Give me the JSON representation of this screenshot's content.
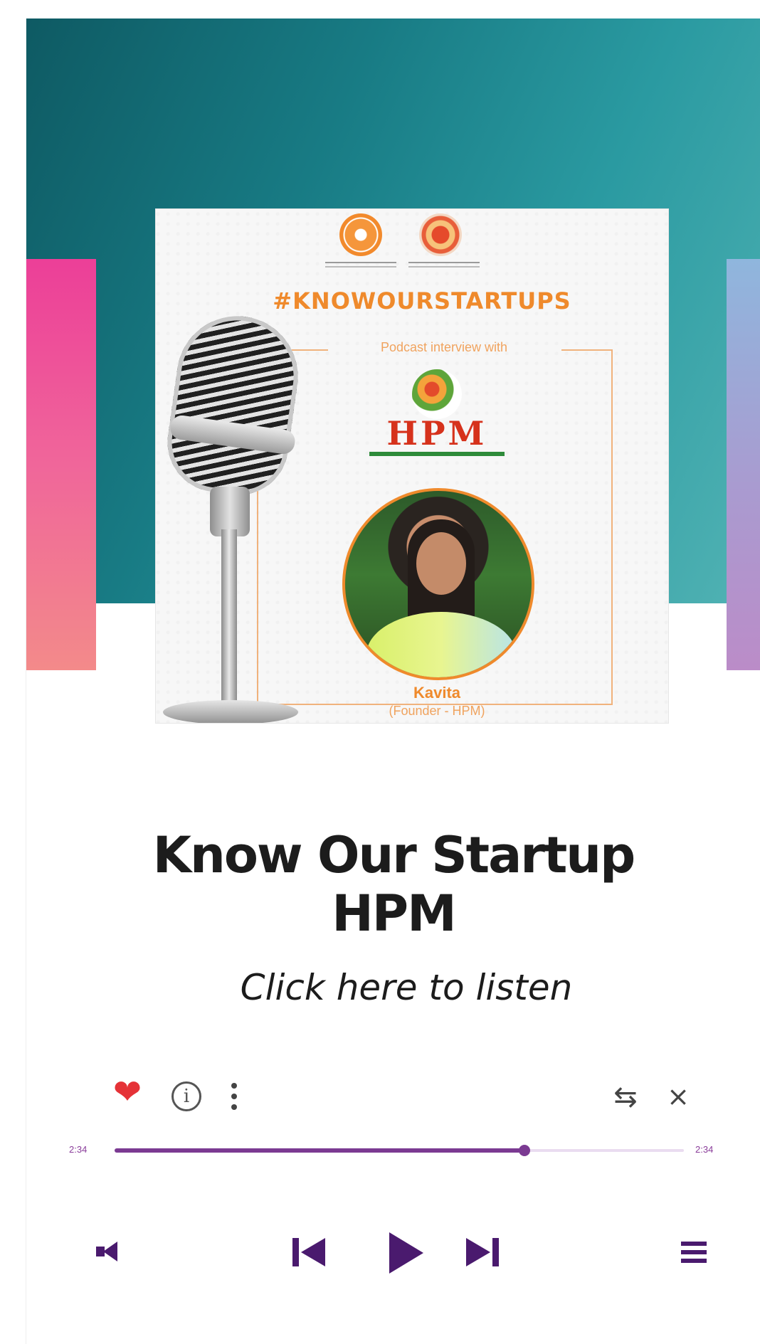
{
  "cover": {
    "hashtag": "#KNOWOURSTARTUPS",
    "podcast_label": "Podcast interview with",
    "brand_logo_text": "HPM",
    "guest_name": "Kavita",
    "guest_role": "(Founder - HPM)"
  },
  "episode": {
    "title_line1": "Know Our Startup",
    "title_line2": "HPM",
    "cta": "Click here to listen"
  },
  "player": {
    "elapsed": "2:34",
    "duration": "2:34",
    "progress_fraction": 0.72,
    "liked": true,
    "accent_color": "#7b3a92",
    "like_color": "#e53237",
    "icons": [
      "heart-icon",
      "info-icon",
      "more-vertical-icon",
      "repeat-icon",
      "shuffle-icon",
      "speaker-icon",
      "skip-previous-icon",
      "play-icon",
      "skip-next-icon",
      "playlist-menu-icon"
    ]
  }
}
